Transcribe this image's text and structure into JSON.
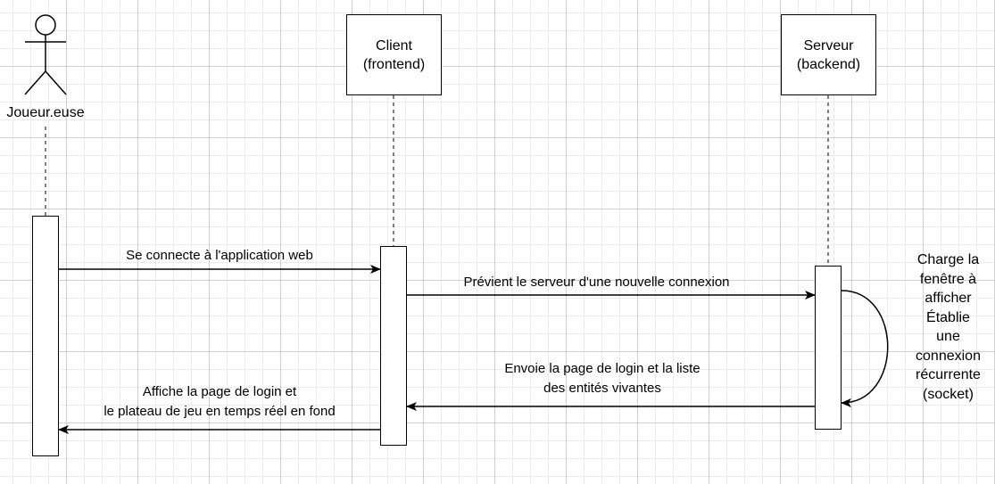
{
  "participants": {
    "player": {
      "label": "Joueur.euse"
    },
    "client": {
      "line1": "Client",
      "line2": "(frontend)"
    },
    "server": {
      "line1": "Serveur",
      "line2": "(backend)"
    }
  },
  "messages": {
    "m1": {
      "line1": "Se connecte à l'application web"
    },
    "m2": {
      "line1": "Prévient le serveur d'une nouvelle connexion"
    },
    "m3": {
      "line1": "Envoie la page de login et la liste",
      "line2": "des entités vivantes"
    },
    "m4": {
      "line1": "Affiche la page de login et",
      "line2": "le plateau de jeu en temps réel en fond"
    }
  },
  "self_message": {
    "lines": [
      "Charge la",
      "fenêtre à",
      "afficher",
      "Établie",
      "une",
      "connexion",
      "récurrente",
      "(socket)"
    ]
  }
}
